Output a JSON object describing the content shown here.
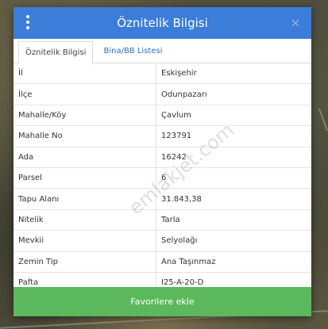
{
  "modal": {
    "title": "Öznitelik Bilgisi",
    "close_icon": "×"
  },
  "tabs": [
    {
      "label": "Öznitelik Bilgisi",
      "active": true
    },
    {
      "label": "Bina/BB Listesi",
      "active": false
    }
  ],
  "rows": [
    {
      "key": "İl",
      "value": "Eskişehir"
    },
    {
      "key": "İlçe",
      "value": "Odunpazarı"
    },
    {
      "key": "Mahalle/Köy",
      "value": "Çavlum"
    },
    {
      "key": "Mahalle No",
      "value": "123791"
    },
    {
      "key": "Ada",
      "value": "16242"
    },
    {
      "key": "Parsel",
      "value": "6"
    },
    {
      "key": "Tapu Alanı",
      "value": "31.843,38"
    },
    {
      "key": "Nitelik",
      "value": "Tarla"
    },
    {
      "key": "Mevkii",
      "value": "Selyolağı"
    },
    {
      "key": "Zemin Tip",
      "value": "Ana Taşınmaz"
    },
    {
      "key": "Pafta",
      "value": "I25-A-20-D"
    }
  ],
  "favorite_button": {
    "label": "Favorilere ekle"
  },
  "watermark": "emlakjet.com",
  "colors": {
    "header": "#3b7dd8",
    "button": "#5cb85c",
    "tab_link": "#2f6fc4"
  }
}
